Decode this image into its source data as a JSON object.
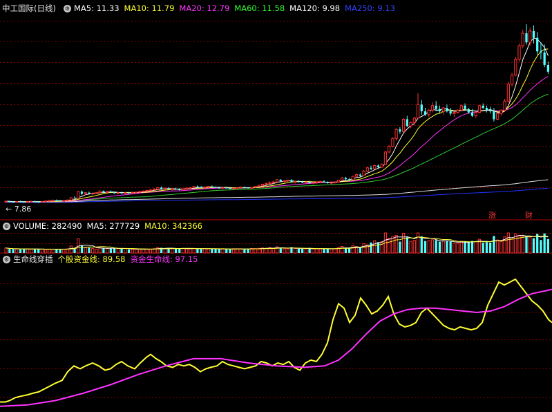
{
  "header": {
    "title": "中工国际(日线)",
    "ma": [
      {
        "label": "MA5: 11.33",
        "color": "#ffffff"
      },
      {
        "label": "MA10: 11.79",
        "color": "#ffff33"
      },
      {
        "label": "MA20: 12.79",
        "color": "#ff33ff"
      },
      {
        "label": "MA60: 11.58",
        "color": "#33ff33"
      },
      {
        "label": "MA120: 9.98",
        "color": "#ffffff"
      },
      {
        "label": "MA250: 9.13",
        "color": "#3344ff"
      }
    ]
  },
  "volume_header": {
    "items": [
      {
        "label": "VOLUME: 282490",
        "color": "#ffffff"
      },
      {
        "label": "MA5: 277729",
        "color": "#ffffff"
      },
      {
        "label": "MA10: 342366",
        "color": "#ffff33"
      }
    ]
  },
  "indicator_header": {
    "title": "生命线穿插",
    "items": [
      {
        "label": "个股资金线: 89.58",
        "color": "#ffff33"
      },
      {
        "label": "资金生命线: 97.15",
        "color": "#ff33ff"
      }
    ]
  },
  "annotations": {
    "low_price": "← 7.86",
    "badge1": "涨",
    "badge2": "财"
  },
  "colors": {
    "up": "#ff3232",
    "down": "#54ffff",
    "grid": "#8b0000",
    "ma5": "#ffffff",
    "ma10": "#ffff33",
    "ma20": "#ff33ff",
    "ma60": "#33cc33",
    "ma120": "#dddddd",
    "ma250": "#2233ff"
  },
  "chart_data": [
    {
      "type": "candlestick",
      "title": "中工国际(日线)",
      "low_marker": 7.86,
      "x_start_day": 0,
      "candles": [
        [
          8.0,
          8.1,
          7.86,
          8.05
        ],
        [
          8.05,
          8.1,
          7.95,
          8.0
        ],
        [
          8.0,
          8.05,
          7.9,
          7.98
        ],
        [
          7.98,
          8.05,
          7.9,
          8.02
        ],
        [
          8.02,
          8.1,
          7.95,
          8.0
        ],
        [
          8.0,
          8.05,
          7.9,
          7.95
        ],
        [
          7.95,
          8.05,
          7.9,
          8.0
        ],
        [
          8.0,
          8.08,
          7.95,
          8.05
        ],
        [
          8.05,
          8.1,
          7.98,
          8.0
        ],
        [
          8.0,
          8.05,
          7.9,
          7.98
        ],
        [
          7.98,
          8.05,
          7.92,
          8.03
        ],
        [
          8.03,
          8.1,
          7.98,
          8.07
        ],
        [
          8.07,
          8.15,
          8.0,
          8.1
        ],
        [
          8.1,
          8.2,
          8.05,
          8.12
        ],
        [
          8.12,
          8.2,
          8.05,
          8.1
        ],
        [
          8.1,
          8.15,
          8.0,
          8.05
        ],
        [
          8.05,
          8.12,
          8.0,
          8.1
        ],
        [
          8.1,
          8.2,
          8.05,
          8.15
        ],
        [
          8.15,
          8.4,
          8.1,
          8.35
        ],
        [
          8.35,
          8.5,
          8.25,
          8.3
        ],
        [
          8.3,
          8.95,
          8.25,
          8.9
        ],
        [
          8.9,
          9.0,
          8.6,
          8.7
        ],
        [
          8.7,
          8.85,
          8.6,
          8.8
        ],
        [
          8.8,
          8.9,
          8.65,
          8.7
        ],
        [
          8.7,
          8.8,
          8.6,
          8.75
        ],
        [
          8.75,
          8.85,
          8.7,
          8.8
        ],
        [
          8.8,
          9.0,
          8.75,
          8.95
        ],
        [
          8.95,
          9.0,
          8.8,
          8.85
        ],
        [
          8.85,
          8.95,
          8.75,
          8.9
        ],
        [
          8.9,
          9.0,
          8.8,
          8.85
        ],
        [
          8.85,
          8.9,
          8.7,
          8.75
        ],
        [
          8.75,
          8.85,
          8.65,
          8.8
        ],
        [
          8.8,
          8.9,
          8.7,
          8.75
        ],
        [
          8.75,
          8.85,
          8.65,
          8.8
        ],
        [
          8.8,
          8.85,
          8.7,
          8.78
        ],
        [
          8.78,
          8.85,
          8.7,
          8.82
        ],
        [
          8.82,
          8.9,
          8.75,
          8.85
        ],
        [
          8.85,
          8.95,
          8.8,
          8.9
        ],
        [
          8.9,
          9.0,
          8.85,
          8.95
        ],
        [
          8.95,
          9.05,
          8.9,
          9.0
        ],
        [
          9.0,
          9.1,
          8.95,
          9.05
        ],
        [
          9.05,
          9.2,
          9.0,
          9.1
        ],
        [
          9.1,
          9.3,
          9.05,
          9.25
        ],
        [
          9.25,
          9.35,
          9.1,
          9.15
        ],
        [
          9.15,
          9.25,
          9.05,
          9.2
        ],
        [
          9.2,
          9.3,
          9.1,
          9.1
        ],
        [
          9.1,
          9.2,
          9.0,
          9.15
        ],
        [
          9.15,
          9.25,
          9.05,
          9.1
        ],
        [
          9.1,
          9.2,
          9.0,
          9.05
        ],
        [
          9.05,
          9.2,
          9.0,
          9.15
        ],
        [
          9.15,
          9.25,
          9.05,
          9.2
        ],
        [
          9.2,
          9.3,
          9.1,
          9.25
        ],
        [
          9.25,
          9.4,
          9.2,
          9.35
        ],
        [
          9.35,
          9.45,
          9.25,
          9.3
        ],
        [
          9.3,
          9.4,
          9.2,
          9.25
        ],
        [
          9.25,
          9.35,
          9.15,
          9.3
        ],
        [
          9.3,
          9.4,
          9.2,
          9.35
        ],
        [
          9.35,
          9.45,
          9.25,
          9.3
        ],
        [
          9.3,
          9.35,
          9.2,
          9.25
        ],
        [
          9.25,
          9.3,
          9.15,
          9.2
        ],
        [
          9.2,
          9.3,
          9.1,
          9.25
        ],
        [
          9.25,
          9.3,
          9.15,
          9.2
        ],
        [
          9.2,
          9.25,
          9.1,
          9.15
        ],
        [
          9.15,
          9.25,
          9.05,
          9.2
        ],
        [
          9.2,
          9.3,
          9.1,
          9.25
        ],
        [
          9.25,
          9.35,
          9.15,
          9.3
        ],
        [
          9.3,
          9.35,
          9.2,
          9.25
        ],
        [
          9.25,
          9.3,
          9.15,
          9.2
        ],
        [
          9.2,
          9.3,
          9.1,
          9.28
        ],
        [
          9.28,
          9.4,
          9.2,
          9.35
        ],
        [
          9.35,
          9.5,
          9.3,
          9.45
        ],
        [
          9.45,
          9.6,
          9.35,
          9.55
        ],
        [
          9.55,
          9.7,
          9.45,
          9.6
        ],
        [
          9.6,
          9.8,
          9.5,
          9.7
        ],
        [
          9.7,
          9.85,
          9.6,
          9.75
        ],
        [
          9.75,
          10.0,
          9.7,
          9.95
        ],
        [
          9.95,
          10.0,
          9.75,
          9.8
        ],
        [
          9.8,
          9.9,
          9.7,
          9.85
        ],
        [
          9.85,
          9.95,
          9.75,
          9.9
        ],
        [
          9.9,
          10.0,
          9.7,
          9.75
        ],
        [
          9.75,
          9.85,
          9.6,
          9.8
        ],
        [
          9.8,
          9.9,
          9.7,
          9.75
        ],
        [
          9.75,
          9.85,
          9.65,
          9.7
        ],
        [
          9.7,
          9.8,
          9.6,
          9.75
        ],
        [
          9.75,
          9.85,
          9.6,
          9.65
        ],
        [
          9.65,
          9.75,
          9.55,
          9.7
        ],
        [
          9.7,
          9.8,
          9.6,
          9.75
        ],
        [
          9.75,
          9.85,
          9.65,
          9.8
        ],
        [
          9.8,
          9.9,
          9.7,
          9.75
        ],
        [
          9.75,
          9.8,
          9.6,
          9.65
        ],
        [
          9.65,
          9.75,
          9.55,
          9.7
        ],
        [
          9.7,
          9.8,
          9.6,
          9.75
        ],
        [
          9.75,
          9.95,
          9.7,
          9.9
        ],
        [
          9.9,
          10.2,
          9.85,
          10.1
        ],
        [
          10.1,
          10.2,
          9.9,
          10.0
        ],
        [
          10.0,
          10.1,
          9.85,
          9.95
        ],
        [
          9.95,
          10.3,
          9.9,
          10.25
        ],
        [
          10.25,
          10.5,
          10.1,
          10.4
        ],
        [
          10.4,
          10.5,
          10.2,
          10.3
        ],
        [
          10.3,
          10.8,
          10.25,
          10.7
        ],
        [
          10.7,
          11.1,
          10.6,
          11.0
        ],
        [
          11.0,
          11.2,
          10.8,
          10.9
        ],
        [
          10.9,
          11.3,
          10.85,
          11.2
        ],
        [
          11.2,
          11.3,
          10.9,
          11.05
        ],
        [
          11.05,
          11.4,
          11.0,
          11.3
        ],
        [
          11.3,
          12.5,
          11.25,
          12.4
        ],
        [
          12.4,
          13.0,
          12.3,
          12.9
        ],
        [
          12.9,
          13.7,
          12.8,
          13.6
        ],
        [
          13.6,
          14.5,
          13.4,
          14.4
        ],
        [
          14.4,
          14.6,
          14.0,
          14.2
        ],
        [
          14.2,
          15.4,
          14.1,
          15.3
        ],
        [
          15.3,
          15.6,
          14.6,
          14.7
        ],
        [
          14.7,
          15.1,
          14.5,
          15.0
        ],
        [
          15.0,
          15.5,
          14.8,
          15.4
        ],
        [
          15.4,
          17.6,
          15.3,
          16.6
        ],
        [
          16.6,
          17.0,
          15.7,
          16.0
        ],
        [
          16.0,
          16.3,
          15.6,
          15.7
        ],
        [
          15.7,
          16.2,
          15.5,
          16.1
        ],
        [
          16.1,
          16.8,
          15.9,
          16.5
        ],
        [
          16.5,
          16.9,
          16.0,
          16.2
        ],
        [
          16.2,
          16.5,
          15.8,
          16.0
        ],
        [
          16.0,
          16.4,
          15.7,
          16.3
        ],
        [
          16.3,
          16.6,
          15.9,
          16.0
        ],
        [
          16.0,
          16.3,
          15.6,
          15.8
        ],
        [
          15.8,
          16.0,
          15.5,
          15.9
        ],
        [
          15.9,
          16.2,
          15.8,
          16.1
        ],
        [
          16.1,
          16.6,
          16.0,
          16.5
        ],
        [
          16.5,
          16.7,
          16.1,
          16.2
        ],
        [
          16.2,
          16.3,
          15.8,
          15.9
        ],
        [
          15.9,
          16.2,
          15.5,
          15.6
        ],
        [
          15.6,
          16.0,
          15.4,
          15.9
        ],
        [
          15.9,
          16.6,
          15.8,
          16.5
        ],
        [
          16.5,
          16.7,
          16.2,
          16.3
        ],
        [
          16.3,
          16.5,
          15.9,
          16.1
        ],
        [
          16.1,
          16.4,
          15.8,
          16.0
        ],
        [
          16.0,
          16.3,
          15.1,
          15.3
        ],
        [
          15.3,
          15.9,
          15.2,
          15.8
        ],
        [
          15.8,
          16.2,
          15.6,
          16.1
        ],
        [
          16.1,
          17.1,
          16.0,
          16.9
        ],
        [
          16.9,
          18.6,
          16.8,
          18.4
        ],
        [
          18.4,
          19.4,
          18.2,
          19.2
        ],
        [
          19.2,
          20.8,
          19.1,
          20.6
        ],
        [
          20.6,
          22.0,
          20.4,
          21.8
        ],
        [
          21.8,
          23.2,
          21.6,
          22.9
        ],
        [
          22.9,
          23.7,
          21.9,
          22.1
        ],
        [
          22.1,
          23.4,
          21.8,
          23.1
        ],
        [
          23.1,
          23.6,
          22.0,
          22.5
        ],
        [
          22.5,
          23.0,
          21.0,
          21.3
        ],
        [
          21.3,
          22.1,
          20.6,
          21.2
        ],
        [
          21.2,
          21.9,
          19.9,
          20.1
        ],
        [
          20.1,
          20.4,
          19.3,
          19.5
        ]
      ],
      "ma": {
        "MA5": 11.33,
        "MA10": 11.79,
        "MA20": 12.79,
        "MA60": 11.58,
        "MA120": 9.98,
        "MA250": 9.13
      }
    },
    {
      "type": "bar",
      "title": "VOLUME",
      "values": [
        282490
      ]
    },
    {
      "type": "line",
      "title": "生命线穿插",
      "series": [
        {
          "name": "个股资金线",
          "x": [
            0,
            8,
            14,
            22,
            30,
            40,
            47,
            56,
            64,
            72,
            80,
            90,
            98,
            107,
            116,
            124,
            134,
            143,
            152,
            160,
            168,
            176,
            185,
            195,
            203,
            212,
            218,
            226,
            233,
            241,
            250,
            258,
            266,
            274,
            282,
            290,
            298,
            305,
            314,
            322,
            330,
            338,
            346,
            354,
            362,
            370,
            378,
            386,
            394,
            402,
            410,
            418,
            426,
            434,
            442,
            450,
            458,
            466,
            474,
            482,
            490,
            498,
            506,
            514,
            522,
            530,
            538,
            546,
            554,
            562,
            570,
            578,
            586,
            594,
            602,
            610,
            618,
            626,
            634,
            642,
            650,
            658,
            666,
            674,
            682,
            690,
            698,
            706,
            714,
            722,
            730,
            738,
            746,
            754,
            762,
            770,
            778,
            786,
            794,
            799
          ],
          "values": [
            5,
            5,
            6,
            8,
            9,
            10,
            11,
            12,
            14,
            16,
            18,
            20,
            26,
            30,
            28,
            30,
            32,
            30,
            27,
            28,
            31,
            33,
            30,
            28,
            32,
            36,
            38,
            35,
            33,
            30,
            29,
            31,
            30,
            31,
            29,
            26,
            28,
            29,
            30,
            33,
            31,
            30,
            29,
            28,
            29,
            30,
            33,
            32,
            30,
            32,
            31,
            33,
            29,
            27,
            32,
            34,
            33,
            38,
            46,
            62,
            73,
            70,
            60,
            65,
            77,
            72,
            66,
            68,
            72,
            78,
            66,
            59,
            57,
            58,
            60,
            67,
            70,
            66,
            62,
            58,
            56,
            55,
            57,
            56,
            55,
            56,
            60,
            72,
            80,
            88,
            86,
            88,
            90,
            85,
            80,
            75,
            72,
            68,
            62,
            60
          ]
        },
        {
          "name": "资金生命线",
          "x": [
            0,
            40,
            80,
            120,
            160,
            200,
            240,
            280,
            320,
            360,
            400,
            440,
            470,
            490,
            510,
            530,
            550,
            570,
            590,
            610,
            630,
            650,
            670,
            690,
            710,
            730,
            750,
            770,
            790,
            799
          ],
          "values": [
            2,
            3,
            6,
            11,
            17,
            24,
            30,
            35,
            35,
            32,
            30,
            29,
            30,
            34,
            42,
            52,
            61,
            66,
            69,
            70,
            70,
            69,
            68,
            67,
            68,
            71,
            76,
            80,
            82,
            83
          ]
        }
      ],
      "ylim": [
        0,
        100
      ]
    }
  ]
}
